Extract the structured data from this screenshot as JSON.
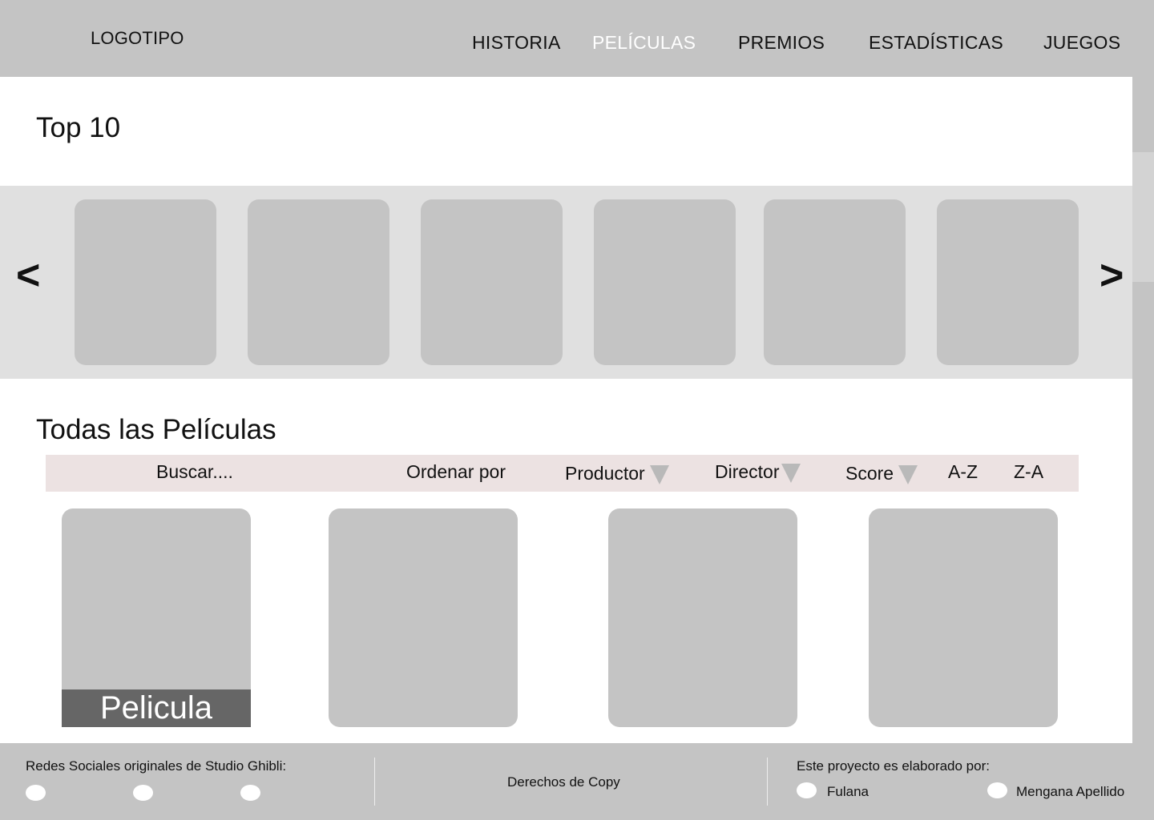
{
  "header": {
    "logo": "LOGOTIPO",
    "nav": [
      "HISTORIA",
      "PELÍCULAS",
      "PREMIOS",
      "ESTADÍSTICAS",
      "JUEGOS"
    ],
    "active_nav": "PELÍCULAS"
  },
  "top10": {
    "title": "Top 10",
    "prev": "<",
    "next": ">"
  },
  "all_films": {
    "title": "Todas las Películas",
    "search_placeholder": "Buscar....",
    "sort_label": "Ordenar por",
    "filters": [
      "Productor",
      "Director",
      "Score"
    ],
    "sort_az": "A-Z",
    "sort_za": "Z-A",
    "first_card_caption": "Pelicula"
  },
  "footer": {
    "social_label": "Redes Sociales originales de Studio Ghibli:",
    "copyright": "Derechos de Copy",
    "credits_label": "Este proyecto es elaborado por:",
    "authors": [
      "Fulana",
      "Mengana Apellido"
    ]
  },
  "colors": {
    "header_bg": "#c4c4c4",
    "active_nav": "#ffffff",
    "carousel_bg": "#e0e0e0",
    "card": "#c4c4c4",
    "filter_bar": "#ece2e2",
    "caption_bg": "#666666"
  }
}
